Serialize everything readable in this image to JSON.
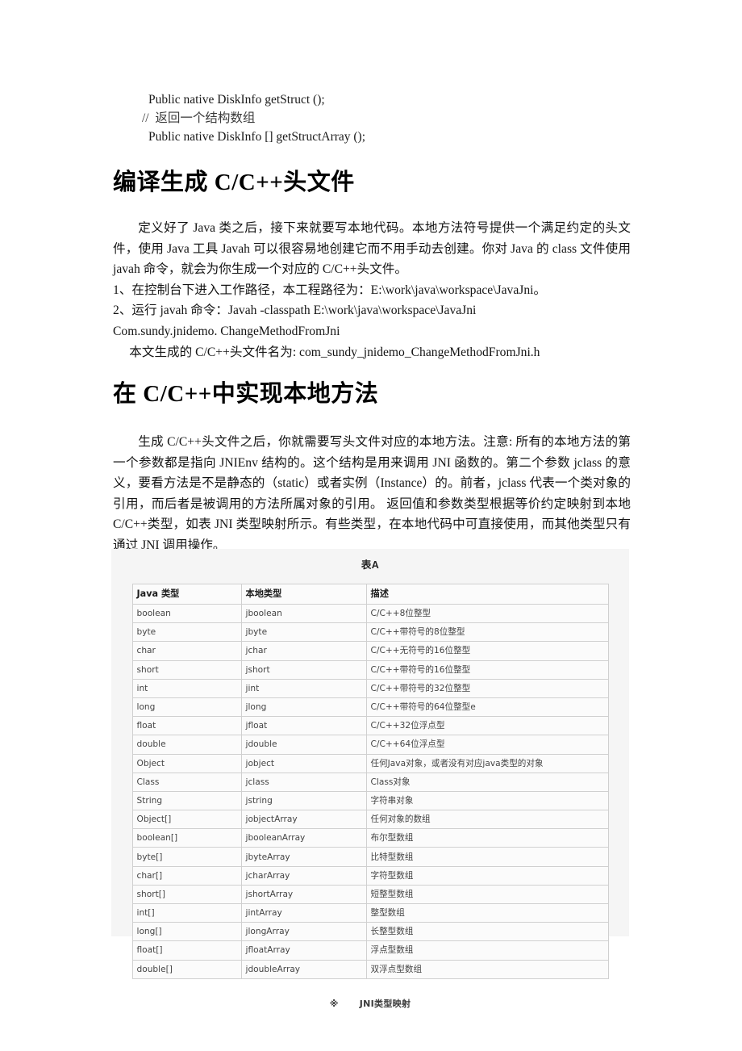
{
  "code_block": {
    "lines": [
      {
        "text": "Public native DiskInfo getStruct ();",
        "style": "indent"
      },
      {
        "text": "//  返回一个结构数组",
        "style": "comment"
      },
      {
        "text": "Public native DiskInfo [] getStructArray ();",
        "style": "indent"
      }
    ]
  },
  "sections": [
    {
      "heading": "编译生成 C/C++头文件",
      "paragraphs": [
        "定义好了 Java 类之后，接下来就要写本地代码。本地方法符号提供一个满足约定的头文件，使用 Java 工具 Javah 可以很容易地创建它而不用手动去创建。你对 Java 的 class 文件使用 javah 命令，就会为你生成一个对应的 C/C++头文件。",
        "1、在控制台下进入工作路径，本工程路径为：E:\\work\\java\\workspace\\JavaJni。",
        "2、运行 javah  命令：Javah -classpath E:\\work\\java\\workspace\\JavaJni",
        "Com.sundy.jnidemo. ChangeMethodFromJni",
        "本文生成的 C/C++头文件名为: com_sundy_jnidemo_ChangeMethodFromJni.h"
      ]
    },
    {
      "heading": "在 C/C++中实现本地方法",
      "paragraphs": [
        "生成 C/C++头文件之后，你就需要写头文件对应的本地方法。注意: 所有的本地方法的第一个参数都是指向 JNIEnv 结构的。这个结构是用来调用 JNI 函数的。第二个参数 jclass 的意义，要看方法是不是静态的（static）或者实例（Instance）的。前者，jclass 代表一个类对象的引用，而后者是被调用的方法所属对象的引用。  返回值和参数类型根据等价约定映射到本地 C/C++类型，如表 JNI 类型映射所示。有些类型，在本地代码中可直接使用，而其他类型只有通过 JNI 调用操作。"
      ]
    }
  ],
  "table": {
    "caption_top": "表A",
    "caption_mark": "※",
    "caption_bottom": "JNI类型映射",
    "headers": [
      "Java 类型",
      "本地类型",
      "描述"
    ],
    "rows": [
      [
        "boolean",
        "jboolean",
        "C/C++8位整型"
      ],
      [
        "byte",
        "jbyte",
        "C/C++带符号的8位整型"
      ],
      [
        "char",
        "jchar",
        "C/C++无符号的16位整型"
      ],
      [
        "short",
        "jshort",
        "C/C++带符号的16位整型"
      ],
      [
        "int",
        "jint",
        "C/C++带符号的32位整型"
      ],
      [
        "long",
        "jlong",
        "C/C++带符号的64位整型e"
      ],
      [
        "float",
        "jfloat",
        "C/C++32位浮点型"
      ],
      [
        "double",
        "jdouble",
        "C/C++64位浮点型"
      ],
      [
        "Object",
        "jobject",
        "任何Java对象，或者没有对应java类型的对象"
      ],
      [
        "Class",
        "jclass",
        "Class对象"
      ],
      [
        "String",
        "jstring",
        "字符串对象"
      ],
      [
        "Object[]",
        "jobjectArray",
        "任何对象的数组"
      ],
      [
        "boolean[]",
        "jbooleanArray",
        "布尔型数组"
      ],
      [
        "byte[]",
        "jbyteArray",
        "比特型数组"
      ],
      [
        "char[]",
        "jcharArray",
        "字符型数组"
      ],
      [
        "short[]",
        "jshortArray",
        "短整型数组"
      ],
      [
        "int[]",
        "jintArray",
        "整型数组"
      ],
      [
        "long[]",
        "jlongArray",
        "长整型数组"
      ],
      [
        "float[]",
        "jfloatArray",
        "浮点型数组"
      ],
      [
        "double[]",
        "jdoubleArray",
        "双浮点型数组"
      ]
    ]
  }
}
